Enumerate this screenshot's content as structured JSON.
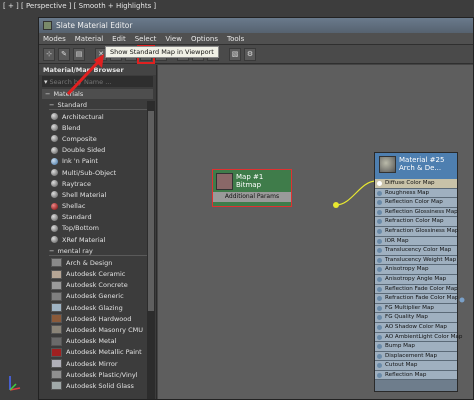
{
  "viewport_label": "[ + ] [ Perspective ] [ Smooth + Highlights ]",
  "window": {
    "title": "Slate Material Editor"
  },
  "menu": [
    "Modes",
    "Material",
    "Edit",
    "Select",
    "View",
    "Options",
    "Tools"
  ],
  "tooltip": "Show Standard Map in Viewport",
  "browser": {
    "title": "Material/Map Browser",
    "search_placeholder": "Search by Name ...",
    "groups": [
      {
        "label": "Materials"
      },
      {
        "label": "Standard"
      },
      {
        "label": "mental ray"
      }
    ],
    "standard_items": [
      "Architectural",
      "Blend",
      "Composite",
      "Double Sided",
      "Ink 'n Paint",
      "Multi/Sub-Object",
      "Raytrace",
      "Shell Material",
      "Shellac",
      "Standard",
      "Top/Bottom",
      "XRef Material"
    ],
    "mentalray_items": [
      "Arch & Design",
      "Autodesk Ceramic",
      "Autodesk Concrete",
      "Autodesk Generic",
      "Autodesk Glazing",
      "Autodesk Hardwood",
      "Autodesk Masonry CMU",
      "Autodesk Metal",
      "Autodesk Metallic Paint",
      "Autodesk Mirror",
      "Autodesk Plastic/Vinyl",
      "Autodesk Solid Glass"
    ]
  },
  "bitmap_node": {
    "line1": "Map #1",
    "line2": "Bitmap",
    "params": "Additional Params"
  },
  "material_node": {
    "line1": "Material #25",
    "line2": "Arch & De...",
    "slots": [
      "Diffuse Color Map",
      "Roughness Map",
      "Reflection Color Map",
      "Reflection Glossiness Map",
      "Refraction Color Map",
      "Refraction Glossiness Map",
      "IOR Map",
      "Translucency Color Map",
      "Translucency Weight Map",
      "Anisotropy Map",
      "Anisotropy Angle Map",
      "Reflection Fade Color Map",
      "Refraction Fade Color Map",
      "FG Multiplier Map",
      "FG Quality Map",
      "AO Shadow Color Map",
      "AO AmbientLight Color Map",
      "Bump Map",
      "Displacement Map",
      "Cutout Map",
      "Reflection Map"
    ]
  }
}
